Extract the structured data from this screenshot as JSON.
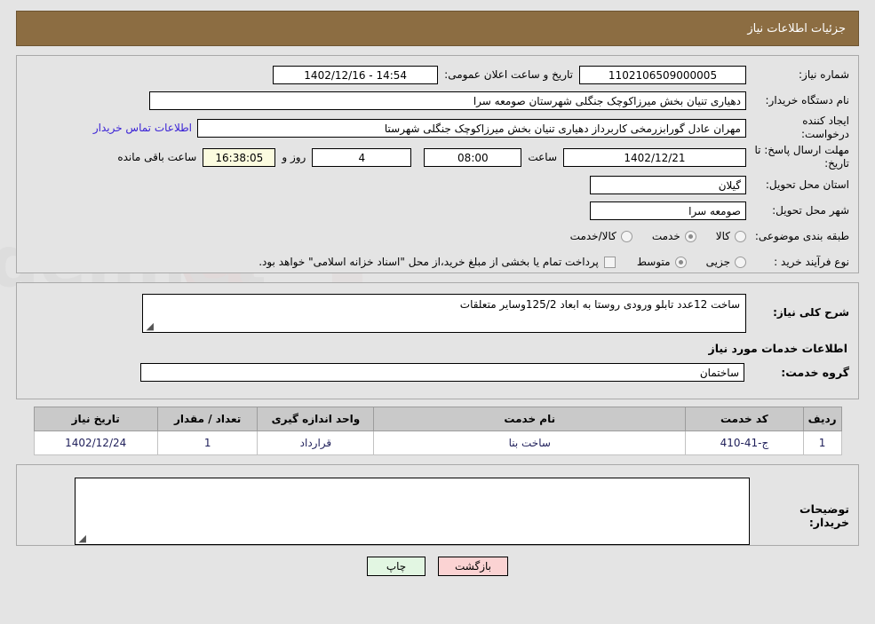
{
  "header": {
    "title": "جزئیات اطلاعات نیاز"
  },
  "form": {
    "need_number_label": "شماره نیاز:",
    "need_number": "1102106509000005",
    "announce_label": "تاریخ و ساعت اعلان عمومی:",
    "announce_value": "14:54 - 1402/12/16",
    "buyer_org_label": "نام دستگاه خریدار:",
    "buyer_org": "دهیاری تنیان بخش میرزاکوچک جنگلی شهرستان صومعه سرا",
    "requester_label": "ایجاد کننده درخواست:",
    "requester": "مهران عادل گورابزرمخی کاربرداز دهیاری تنیان بخش میرزاکوچک جنگلی شهرستا",
    "contact_link": "اطلاعات تماس خریدار",
    "deadline_label": "مهلت ارسال پاسخ: تا تاریخ:",
    "deadline_date": "1402/12/21",
    "hour_label": "ساعت",
    "deadline_hour": "08:00",
    "days_value": "4",
    "days_label": "روز و",
    "countdown": "16:38:05",
    "remaining_label": "ساعت باقی مانده",
    "province_label": "استان محل تحویل:",
    "province": "گیلان",
    "city_label": "شهر محل تحویل:",
    "city": "صومعه سرا",
    "category_label": "طبقه بندی موضوعی:",
    "category_options": [
      "کالا",
      "خدمت",
      "کالا/خدمت"
    ],
    "category_selected": "خدمت",
    "process_label": "نوع فرآیند خرید :",
    "process_options": [
      "جزیی",
      "متوسط"
    ],
    "process_selected": "متوسط",
    "payment_checked": false,
    "payment_note": "پرداخت تمام یا بخشی از مبلغ خرید،از محل \"اسناد خزانه اسلامی\" خواهد بود."
  },
  "description": {
    "label": "شرح کلی نیاز:",
    "value": "ساخت 12عدد تابلو ورودی روستا به ابعاد 125/2وسایر متعلقات",
    "section_title": "اطلاعات خدمات مورد نیاز",
    "service_group_label": "گروه خدمت:",
    "service_group": "ساختمان"
  },
  "table": {
    "columns": [
      "ردیف",
      "کد خدمت",
      "نام خدمت",
      "واحد اندازه گیری",
      "تعداد / مقدار",
      "تاریخ نیاز"
    ],
    "rows": [
      {
        "index": "1",
        "code": "ج-41-410",
        "name": "ساخت بنا",
        "unit": "قرارداد",
        "qty": "1",
        "date": "1402/12/24"
      }
    ]
  },
  "comments": {
    "label": "توضیحات خریدار:",
    "value": ""
  },
  "footer": {
    "print_label": "چاپ",
    "back_label": "بازگشت"
  },
  "colors": {
    "header_bar": "#8c6d42",
    "link": "#3a22d6",
    "countdown_bg": "#fbfbdf",
    "back_button": "#fbd3d3",
    "print_button": "#e2f6e2",
    "table_header": "#c9c9c9"
  },
  "watermark": {
    "text": "AriaTender.net"
  }
}
